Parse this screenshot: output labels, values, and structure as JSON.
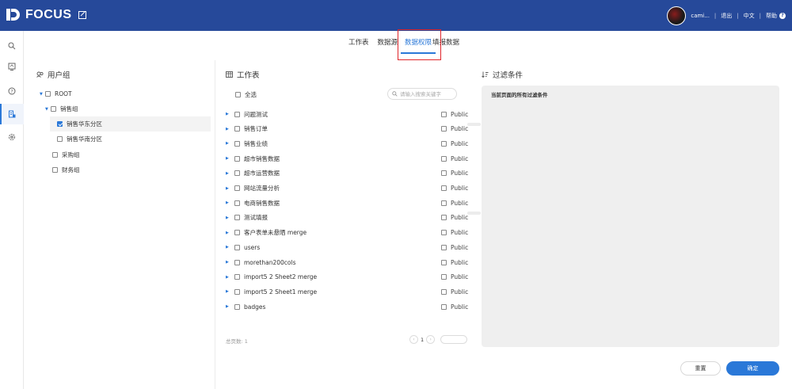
{
  "app": {
    "logo_text": "FOCUS",
    "user_name": "cami...",
    "logout": "退出",
    "language": "中文",
    "help": "帮助",
    "accent_color": "#2a78d8",
    "topbar_color": "#26499a"
  },
  "nav": {
    "icons": [
      "search-icon",
      "board-icon",
      "question-icon",
      "data-icon",
      "settings-icon"
    ]
  },
  "tabs": [
    {
      "label": "工作表",
      "active": false
    },
    {
      "label": "数据源",
      "active": false
    },
    {
      "label": "数据权限",
      "active": true
    },
    {
      "label": "填报数据",
      "active": false
    }
  ],
  "user_group": {
    "title": "用户组",
    "tree": [
      {
        "label": "ROOT",
        "level": 0,
        "expanded": true,
        "checked": false
      },
      {
        "label": "销售组",
        "level": 1,
        "expanded": true,
        "checked": false
      },
      {
        "label": "销售华东分区",
        "level": 2,
        "checked": true,
        "selected": true
      },
      {
        "label": "销售华南分区",
        "level": 2,
        "checked": false
      },
      {
        "label": "采购组",
        "level": 1,
        "checked": false
      },
      {
        "label": "财务组",
        "level": 1,
        "checked": false
      }
    ]
  },
  "worksheets": {
    "title": "工作表",
    "select_all": "全选",
    "search_placeholder": "请输入搜索关键字",
    "public_label": "Public",
    "rows": [
      "问题测试",
      "销售订单",
      "销售业绩",
      "超市销售数据",
      "超市运营数据",
      "网站流量分析",
      "电商销售数据",
      "测试填报",
      "客户表单未悬晒 merge",
      "users",
      "morethan200cols",
      "import5 2 Sheet2 merge",
      "import5 2 Sheet1 merge",
      "badges"
    ],
    "total_label": "总页数: 1",
    "current_page": "1"
  },
  "filter": {
    "title": "过滤条件",
    "label": "当前页面的所有过滤条件"
  },
  "buttons": {
    "reset": "重置",
    "confirm": "确定"
  }
}
